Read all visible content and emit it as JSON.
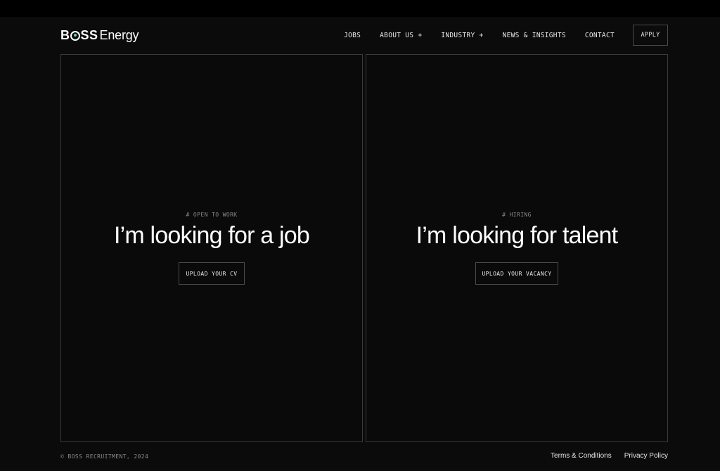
{
  "brand": {
    "part1": "B",
    "part2": "SS",
    "part3": "Energy",
    "accent_color": "#5fd3a3"
  },
  "nav": {
    "items": [
      {
        "label": "JOBS"
      },
      {
        "label": "ABOUT US +"
      },
      {
        "label": "INDUSTRY +"
      },
      {
        "label": "NEWS & INSIGHTS"
      },
      {
        "label": "CONTACT"
      }
    ],
    "apply_label": "APPLY"
  },
  "panels": {
    "left": {
      "kicker": "# OPEN TO WORK",
      "headline": "I’m looking for a job",
      "cta": "UPLOAD YOUR CV"
    },
    "right": {
      "kicker": "# HIRING",
      "headline": "I’m looking for talent",
      "cta": "UPLOAD YOUR VACANCY"
    }
  },
  "footer": {
    "copyright": "© BOSS RECRUITMENT, 2024",
    "links": [
      {
        "label": "Terms & Conditions"
      },
      {
        "label": "Privacy Policy"
      }
    ]
  },
  "colors": {
    "background": "#0b0b0b",
    "border": "#3a3a3a",
    "text": "#ffffff",
    "muted": "#8a8a8a"
  }
}
